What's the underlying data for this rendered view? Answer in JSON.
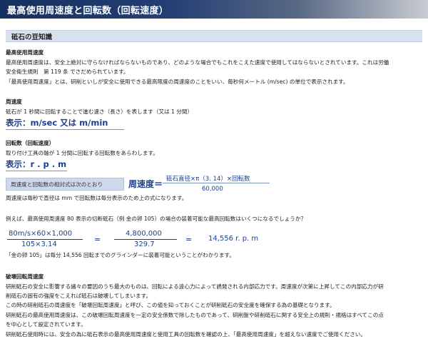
{
  "header": {
    "title": "最高使用周速度と回転数（回転速度）"
  },
  "section": {
    "title": "砥石の豆知識"
  },
  "max_speed": {
    "heading": "最高使用周速度",
    "line1": "最高使用周速度は、安全上絶対に守らなければならないものであり、どのような場合でもこれをこえた速度で使用してはならないとされています。これは労働",
    "line2": "安全衛生規則　第 119 条 でさだめられています。",
    "line3": "「最高使用周速度」とは、研削といしが安全に使用できる最高限度の周速度のことをいい、毎秒何メートル (m/sec) の単位で表示されます。"
  },
  "peripheral": {
    "heading": "周速度",
    "line1": "砥石が 1 秒間に回転することで進む速さ（長さ）を表します（又は 1 分間）",
    "display": "表示：m/sec 又は m/min"
  },
  "rpm": {
    "heading": "回転数（回転速度）",
    "line1": "取り付け工具の軸が 1 分間に回転する回転数をあらわします。",
    "display": "表示：r . p . m"
  },
  "relation": {
    "pill": "周速度と回転数の相対式は次のとおり",
    "lhs": "周速度＝",
    "numerator": "砥石直径×π（3. 14）×回転数",
    "denominator": "60,000",
    "note": "周速度は毎秒で直径は mm で回転数は毎分表示のため上の式になります。"
  },
  "example": {
    "question": "例えば、最高使用周速度 80 表示の切断砥石（例 金の卵 105）の場合の装着可能な最高回転数はいくつになるでしょうか？",
    "frac1_num": "80m/s×60×1,000",
    "frac1_den": "105×3.14",
    "eq1": "=",
    "frac2_num": "4,800,000",
    "frac2_den": "329.7",
    "eq2": "=",
    "result": "14,556 r. p. m",
    "conclusion": "「金の卵 105」は毎分 14,556 回転までのグラインダーに装着可能ということがわかります。"
  },
  "breakage": {
    "heading": "破壊回転周速度",
    "line1": "研削砥石の安全に影響する諸々の要因のうち最大のものは、回転による遠心力によって誘発される内部応力です。周速度が次第に上昇してこの内部応力が研",
    "line2": "削砥石の固有の強度をこえれば砥石は破壊してしまいます。",
    "line3": "この時の研削砥石の周速度を「破壊回転周速度」と呼び、この値を知っておくことが研削砥石の安全度を確保する為の基礎となります。",
    "line4": "研削砥石の最高使用周速度は、この破壊回転周速度を一定の安全係数で除したものであって、研削盤や研削砥石に関する安全上の規則・規格はすべてこの点",
    "line5": "を中心として設定されています。",
    "line6": "研削砥石使用時には、安全の為に砥石表示の最高使用周速度と使用工具の回転数を確認の上、「最高使用周速度」を超えない速度でご使用ください。"
  }
}
